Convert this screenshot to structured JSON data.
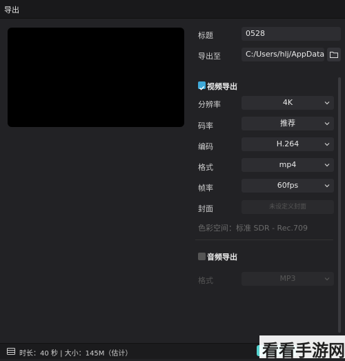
{
  "header": {
    "title": "导出"
  },
  "form": {
    "title_label": "标题",
    "title_value": "0528",
    "path_label": "导出至",
    "path_value": "C:/Users/hlj/AppData..."
  },
  "video": {
    "section_title": "视频导出",
    "checked": true,
    "rows": [
      {
        "label": "分辨率",
        "value": "4K"
      },
      {
        "label": "码率",
        "value": "推荐"
      },
      {
        "label": "编码",
        "value": "H.264"
      },
      {
        "label": "格式",
        "value": "mp4"
      },
      {
        "label": "帧率",
        "value": "60fps"
      }
    ],
    "cover_label": "封面",
    "cover_value": "未设定义封面",
    "color_space": "色彩空间：标准 SDR - Rec.709"
  },
  "audio": {
    "section_title": "音频导出",
    "checked": false,
    "format_label": "格式",
    "format_value": "MP3"
  },
  "footer": {
    "info": "时长：40 秒 | 大小：145M（估计）"
  },
  "watermark": {
    "text": "看看手游网"
  },
  "colors": {
    "accent": "#3fa9d8",
    "export": "#54d4d0",
    "background": "#222225"
  }
}
